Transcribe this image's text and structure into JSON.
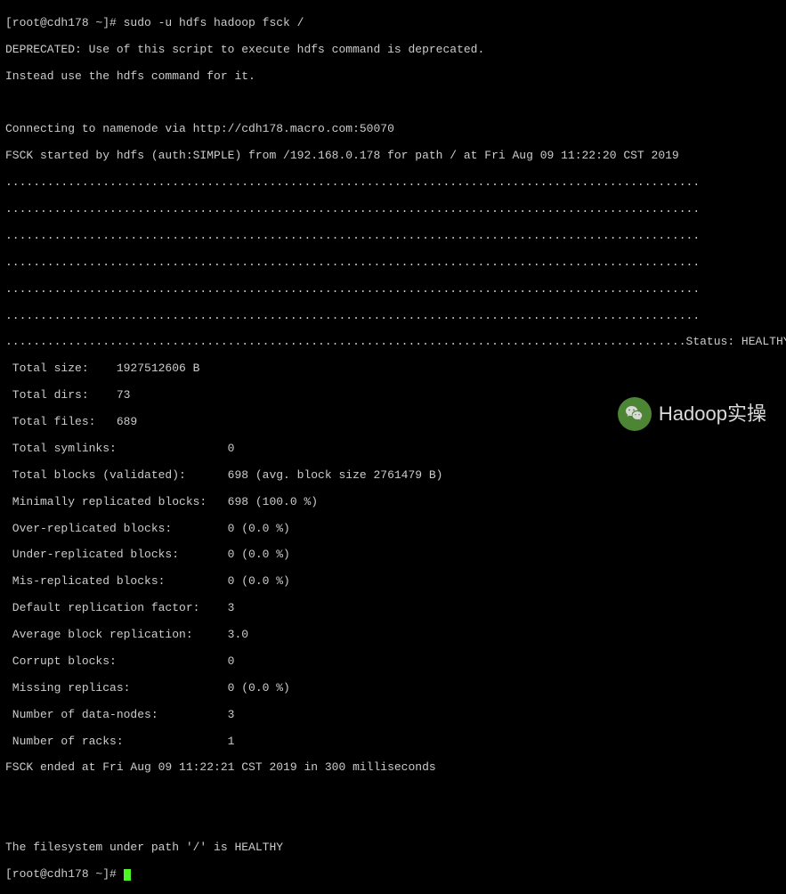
{
  "prompt1": "[root@cdh178 ~]# ",
  "command": "sudo -u hdfs hadoop fsck /",
  "deprecated1": "DEPRECATED: Use of this script to execute hdfs command is deprecated.",
  "deprecated2": "Instead use the hdfs command for it.",
  "connecting": "Connecting to namenode via http://cdh178.macro.com:50070",
  "fsck_start": "FSCK started by hdfs (auth:SIMPLE) from /192.168.0.178 for path / at Fri Aug 09 11:22:20 CST 2019",
  "dots1": "....................................................................................................",
  "dots2": "....................................................................................................",
  "dots3": "....................................................................................................",
  "dots4": "....................................................................................................",
  "dots5": "....................................................................................................",
  "dots6": "....................................................................................................",
  "dots_status": "..................................................................................................Status: HEALTHY",
  "stats": {
    "total_size": " Total size:    1927512606 B",
    "total_dirs": " Total dirs:    73",
    "total_files": " Total files:   689",
    "total_symlinks": " Total symlinks:                0",
    "total_blocks": " Total blocks (validated):      698 (avg. block size 2761479 B)",
    "min_replicated": " Minimally replicated blocks:   698 (100.0 %)",
    "over_replicated": " Over-replicated blocks:        0 (0.0 %)",
    "under_replicated": " Under-replicated blocks:       0 (0.0 %)",
    "mis_replicated": " Mis-replicated blocks:         0 (0.0 %)",
    "default_repl": " Default replication factor:    3",
    "avg_repl": " Average block replication:     3.0",
    "corrupt": " Corrupt blocks:                0",
    "missing": " Missing replicas:              0 (0.0 %)",
    "data_nodes": " Number of data-nodes:          3",
    "racks": " Number of racks:               1"
  },
  "fsck_end": "FSCK ended at Fri Aug 09 11:22:21 CST 2019 in 300 milliseconds",
  "healthy": "The filesystem under path '/' is HEALTHY",
  "prompt2": "[root@cdh178 ~]# ",
  "watermark_text": "Hadoop实操"
}
